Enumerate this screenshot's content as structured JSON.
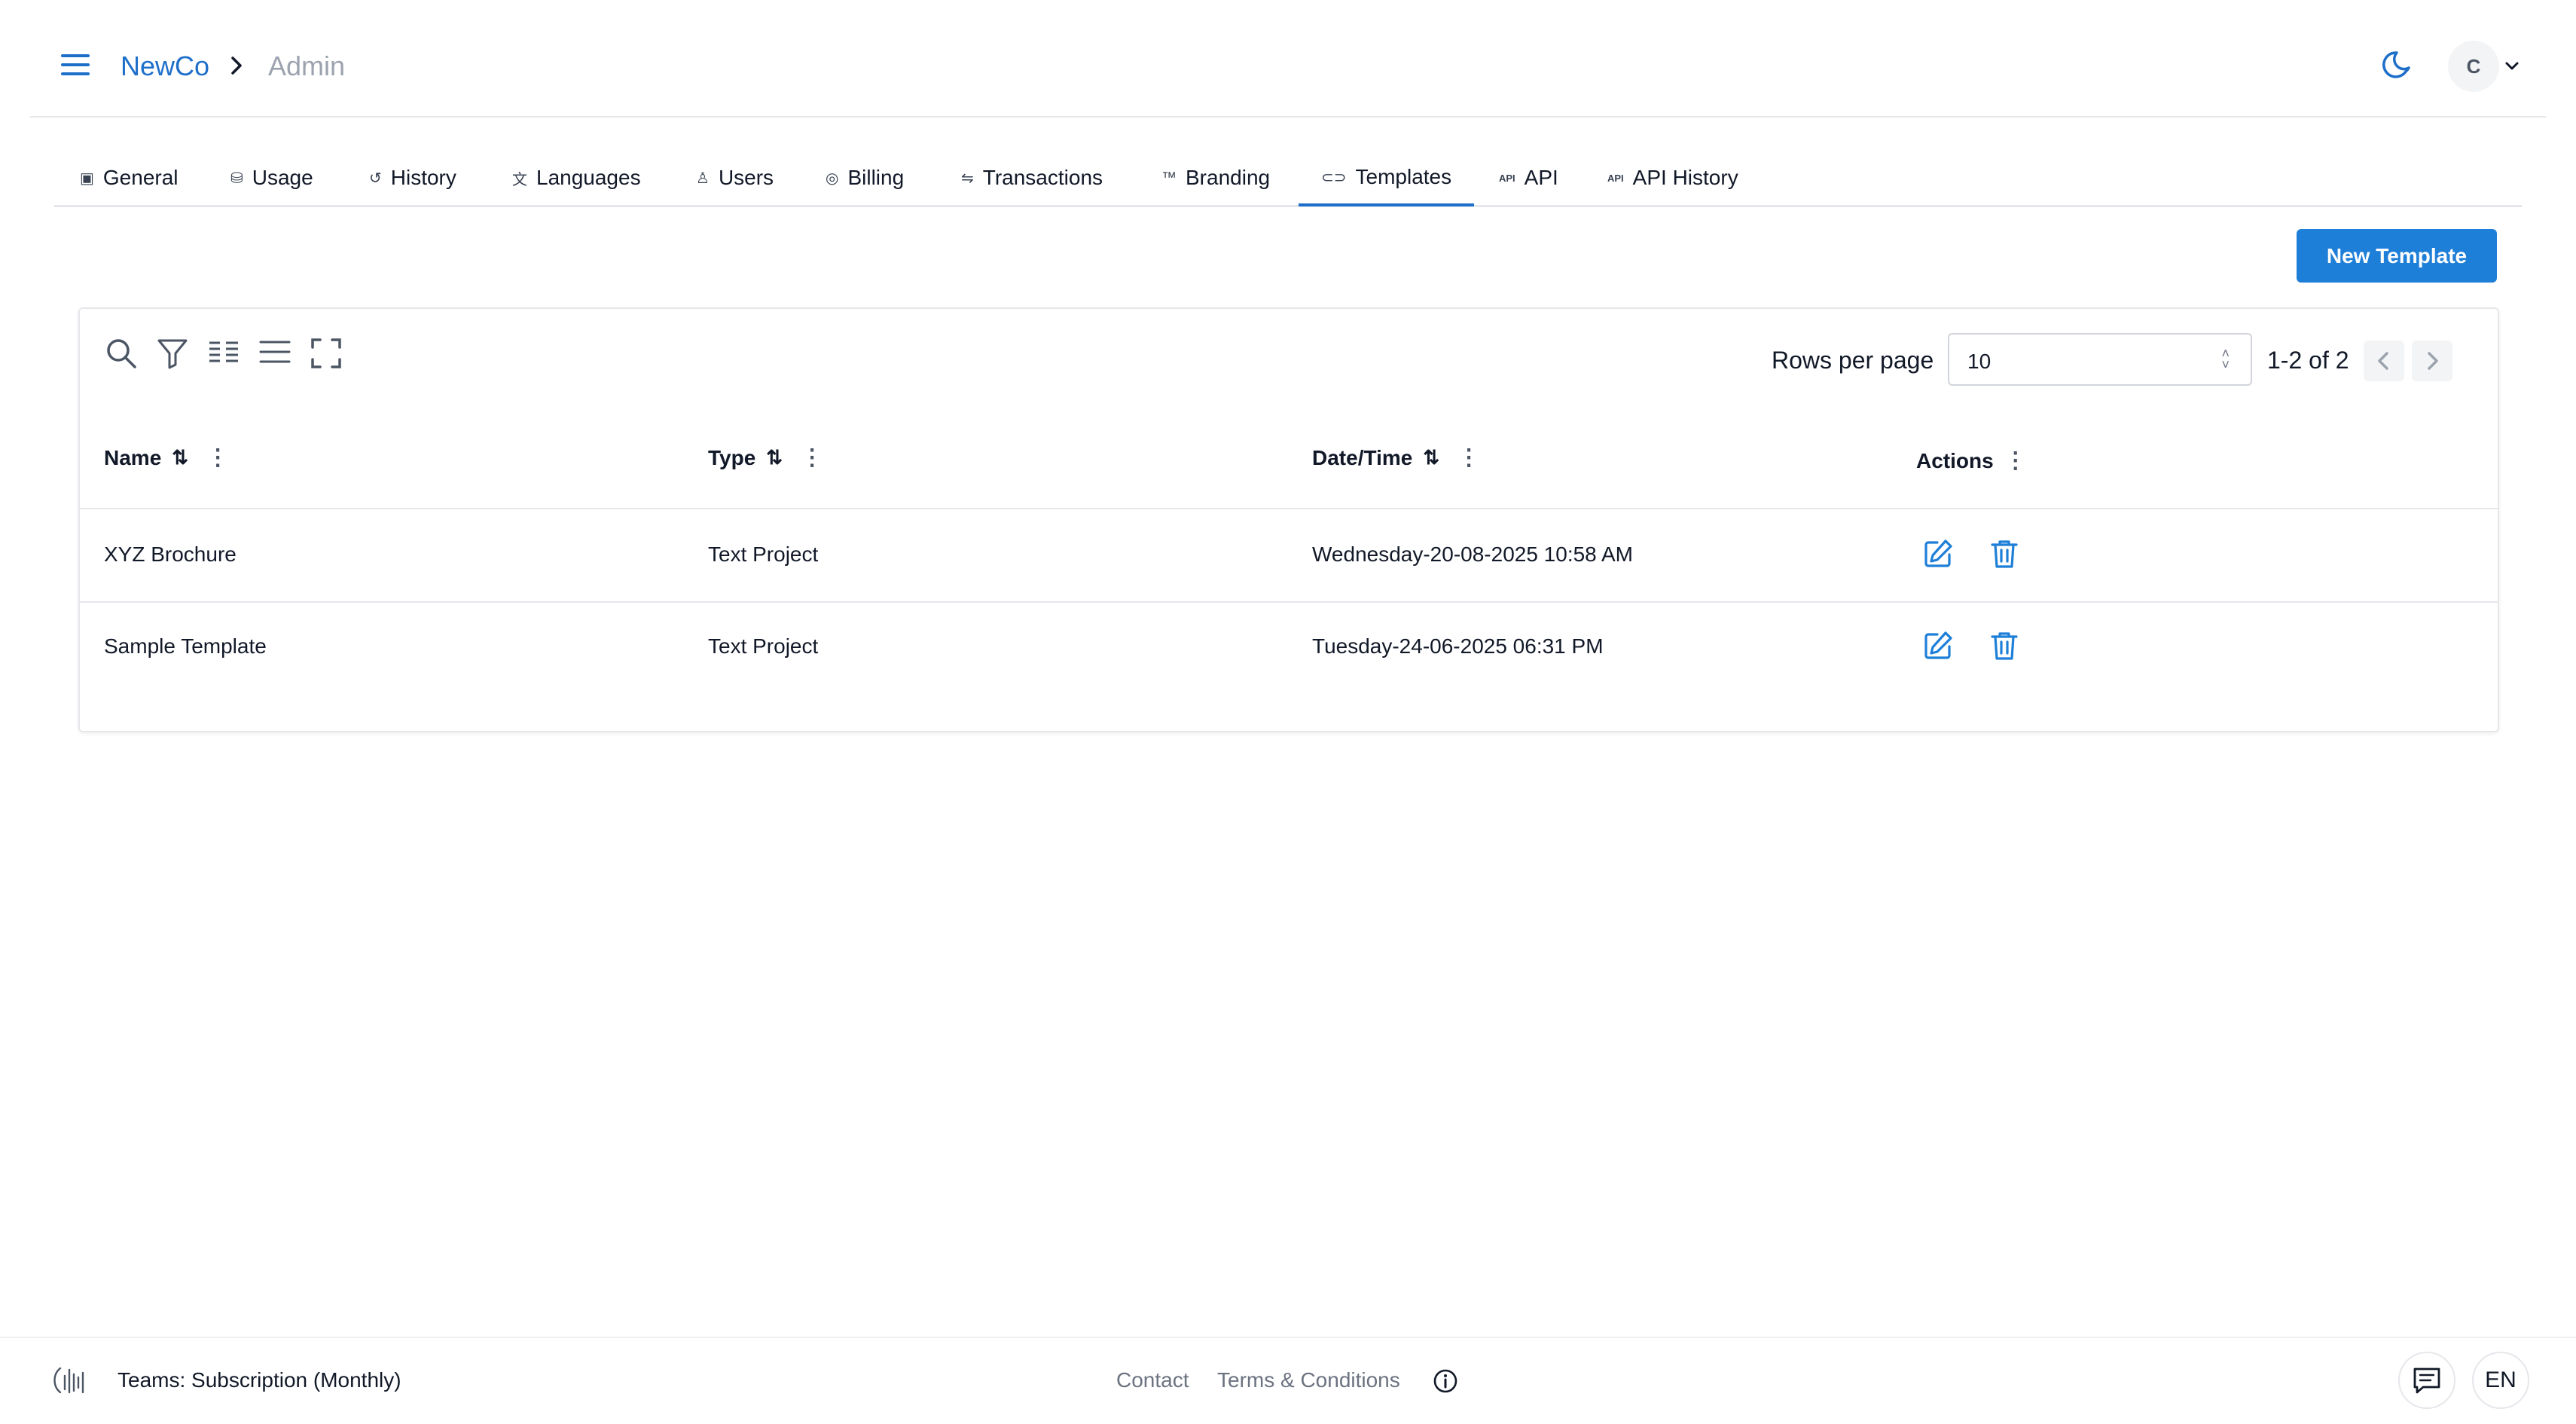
{
  "header": {
    "brand": "NewCo",
    "page": "Admin",
    "avatar_initial": "C"
  },
  "tabs": [
    {
      "label": "General",
      "icon": "info-box-icon"
    },
    {
      "label": "Usage",
      "icon": "database-icon"
    },
    {
      "label": "History",
      "icon": "history-icon"
    },
    {
      "label": "Languages",
      "icon": "translate-icon"
    },
    {
      "label": "Users",
      "icon": "user-icon"
    },
    {
      "label": "Billing",
      "icon": "coins-icon"
    },
    {
      "label": "Transactions",
      "icon": "swap-icon"
    },
    {
      "label": "Branding",
      "icon": "trademark-icon"
    },
    {
      "label": "Templates",
      "icon": "template-icon",
      "active": true
    },
    {
      "label": "API",
      "icon": "api-icon"
    },
    {
      "label": "API History",
      "icon": "api-icon"
    }
  ],
  "actions": {
    "new_template": "New Template"
  },
  "table": {
    "rows_per_page_label": "Rows per page",
    "rows_per_page": "10",
    "range": "1-2 of 2",
    "columns": [
      "Name",
      "Type",
      "Date/Time",
      "Actions"
    ],
    "rows": [
      {
        "name": "XYZ Brochure",
        "type": "Text Project",
        "datetime": "Wednesday-20-08-2025 10:58 AM"
      },
      {
        "name": "Sample Template",
        "type": "Text Project",
        "datetime": "Tuesday-24-06-2025 06:31 PM"
      }
    ]
  },
  "footer": {
    "subscription": "Teams: Subscription (Monthly)",
    "contact": "Contact",
    "terms": "Terms & Conditions",
    "language": "EN"
  },
  "colors": {
    "accent": "#1e7fd8",
    "link": "#1e6fc9"
  }
}
